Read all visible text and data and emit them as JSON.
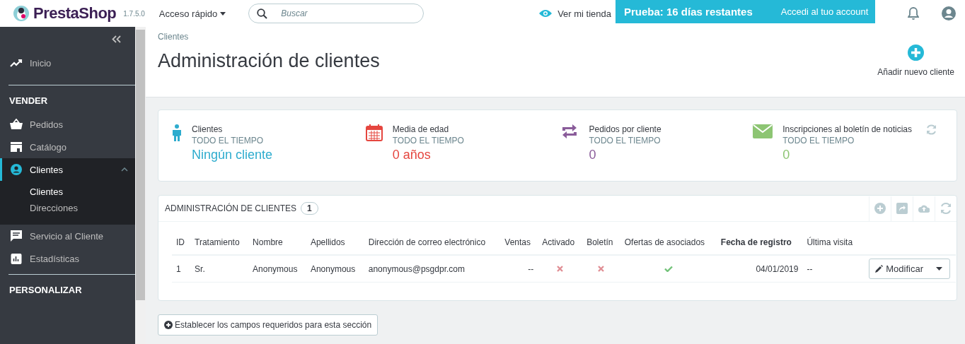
{
  "header": {
    "logo": "PrestaShop",
    "version": "1.7.5.0",
    "quick_access": "Acceso rápido",
    "search": {
      "placeholder": "Buscar"
    },
    "view_store": "Ver mi tienda",
    "trial": {
      "text": "Prueba: 16 días restantes",
      "link": "Accedi al tuo account"
    }
  },
  "sidebar": {
    "items": [
      {
        "kind": "link",
        "label": "Inicio",
        "selected": false
      },
      {
        "kind": "section",
        "label": "VENDER"
      },
      {
        "kind": "link",
        "label": "Pedidos",
        "selected": false
      },
      {
        "kind": "link",
        "label": "Catálogo",
        "selected": false
      },
      {
        "kind": "link",
        "label": "Clientes",
        "selected": true,
        "expanded": true,
        "children": [
          {
            "label": "Clientes",
            "selected": true
          },
          {
            "label": "Direcciones",
            "selected": false
          }
        ]
      },
      {
        "kind": "link",
        "label": "Servicio al Cliente",
        "selected": false
      },
      {
        "kind": "link",
        "label": "Estadísticas",
        "selected": false
      },
      {
        "kind": "section",
        "label": "PERSONALIZAR"
      }
    ]
  },
  "page": {
    "breadcrumb": "Clientes",
    "title": "Administración de clientes",
    "add_button": "Añadir nuevo cliente"
  },
  "kpis": [
    {
      "label": "Clientes",
      "period": "TODO EL TIEMPO",
      "value": "Ningún cliente",
      "color": "#2eacce"
    },
    {
      "label": "Media de edad",
      "period": "TODO EL TIEMPO",
      "value": "0 años",
      "color": "#e5463f"
    },
    {
      "label": "Pedidos por cliente",
      "period": "TODO EL TIEMPO",
      "value": "0",
      "color": "#8a5c9a"
    },
    {
      "label": "Inscripciones al boletín de noticias",
      "period": "TODO EL TIEMPO",
      "value": "0",
      "color": "#8dc573"
    }
  ],
  "table": {
    "title": "ADMINISTRACIÓN DE CLIENTES",
    "count": "1",
    "columns": [
      {
        "label": "ID",
        "sorted": false
      },
      {
        "label": "Tratamiento",
        "sorted": false
      },
      {
        "label": "Nombre",
        "sorted": false
      },
      {
        "label": "Apellidos",
        "sorted": false
      },
      {
        "label": "Dirección de correo electrónico",
        "sorted": false
      },
      {
        "label": "Ventas",
        "sorted": false
      },
      {
        "label": "Activado",
        "sorted": false
      },
      {
        "label": "Boletín",
        "sorted": false
      },
      {
        "label": "Ofertas de asociados",
        "sorted": false
      },
      {
        "label": "Fecha de registro",
        "sorted": true
      },
      {
        "label": "Última visita",
        "sorted": false
      }
    ],
    "rows": [
      {
        "id": "1",
        "title": "Sr.",
        "first_name": "Anonymous",
        "last_name": "Anonymous",
        "email": "anonymous@psgdpr.com",
        "sales": "--",
        "active": false,
        "newsletter": false,
        "optin": true,
        "date": "04/01/2019",
        "last_visit": "--",
        "action": "Modificar"
      }
    ]
  },
  "required_fields_button": "Establecer los campos requeridos para esta sección"
}
